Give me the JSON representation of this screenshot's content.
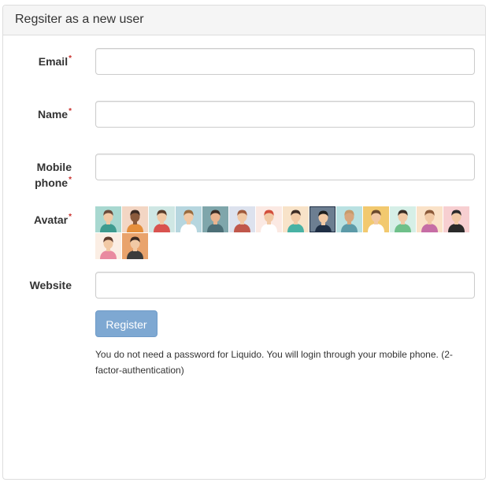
{
  "panel": {
    "title": "Regsiter as a new user"
  },
  "form": {
    "required_mark": "*",
    "email": {
      "label": "Email",
      "value": "",
      "placeholder": ""
    },
    "name": {
      "label": "Name",
      "value": "",
      "placeholder": ""
    },
    "mobile": {
      "label_line1": "Mobile",
      "label_line2": "phone",
      "value": "",
      "placeholder": ""
    },
    "avatar": {
      "label": "Avatar",
      "selected_index": 8,
      "avatars": [
        {
          "bg": "#a8d8d0",
          "hair": "#6b4b3a",
          "skin": "#f1c9a5",
          "shirt": "#3e9b8f"
        },
        {
          "bg": "#f3d6c4",
          "hair": "#3b2a22",
          "skin": "#8a5a3c",
          "shirt": "#e58f3c"
        },
        {
          "bg": "#cfe7e4",
          "hair": "#5a3d2b",
          "skin": "#f1c9a5",
          "shirt": "#d9534f"
        },
        {
          "bg": "#b6d6df",
          "hair": "#9a6b3e",
          "skin": "#f1c9a5",
          "shirt": "#ffffff"
        },
        {
          "bg": "#7fa6ab",
          "hair": "#3a2d25",
          "skin": "#e8b48f",
          "shirt": "#4c6f77"
        },
        {
          "bg": "#dde2ee",
          "hair": "#a05a3c",
          "skin": "#f1c9a5",
          "shirt": "#c0574b"
        },
        {
          "bg": "#fbe9e3",
          "hair": "#d34f3c",
          "skin": "#f1c9a5",
          "shirt": "#ffffff"
        },
        {
          "bg": "#f8e3c9",
          "hair": "#3d2b24",
          "skin": "#f1c9a5",
          "shirt": "#48b2a4"
        },
        {
          "bg": "#6c7e91",
          "hair": "#1d1d1d",
          "skin": "#f1c9a5",
          "shirt": "#1f2f45"
        },
        {
          "bg": "#b9e1e2",
          "hair": "#c79a6b",
          "skin": "#d8a67d",
          "shirt": "#5c9aa8"
        },
        {
          "bg": "#f2c96f",
          "hair": "#6b4a2e",
          "skin": "#f1c9a5",
          "shirt": "#ffffff"
        },
        {
          "bg": "#d6efe7",
          "hair": "#3a2d25",
          "skin": "#f1c9a5",
          "shirt": "#6fc08a"
        },
        {
          "bg": "#fae2c8",
          "hair": "#8b5a3a",
          "skin": "#f1c9a5",
          "shirt": "#c66da5"
        },
        {
          "bg": "#f7cfd1",
          "hair": "#2a2a2a",
          "skin": "#f1c9a5",
          "shirt": "#2a2a2a"
        },
        {
          "bg": "#fbeee4",
          "hair": "#5d3b2c",
          "skin": "#f1c9a5",
          "shirt": "#e98aa0"
        },
        {
          "bg": "#e9a36c",
          "hair": "#3b2a22",
          "skin": "#f1c9a5",
          "shirt": "#3c3c3c"
        }
      ]
    },
    "website": {
      "label": "Website",
      "value": "",
      "placeholder": ""
    },
    "register_label": "Register",
    "help_text": "You do not need a password for Liquido. You will login through your mobile phone. (2-factor-authentication)"
  }
}
